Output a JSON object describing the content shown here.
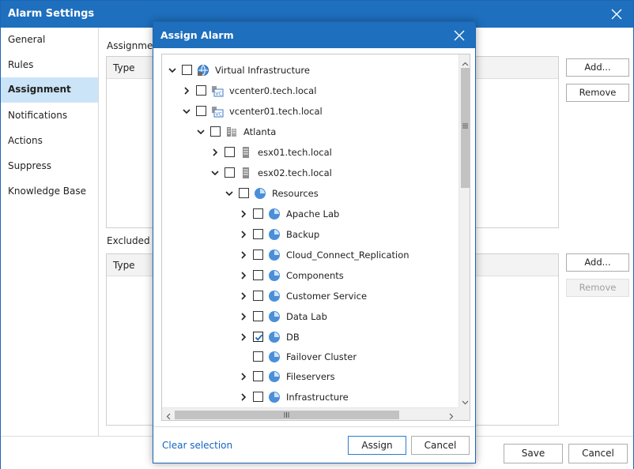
{
  "window": {
    "title": "Alarm Settings"
  },
  "sidebar": {
    "items": [
      {
        "label": "General"
      },
      {
        "label": "Rules"
      },
      {
        "label": "Assignment"
      },
      {
        "label": "Notifications"
      },
      {
        "label": "Actions"
      },
      {
        "label": "Suppress"
      },
      {
        "label": "Knowledge Base"
      }
    ],
    "active": "Assignment"
  },
  "assignment": {
    "assign_label": "Assignment",
    "assign_type_header": "Type",
    "excluded_label": "Excluded ob",
    "excluded_type_header": "Type",
    "add_label": "Add...",
    "remove_label": "Remove",
    "add2_label": "Add...",
    "remove2_label": "Remove"
  },
  "footer": {
    "save_label": "Save",
    "cancel_label": "Cancel"
  },
  "dialog": {
    "title": "Assign Alarm",
    "clear_label": "Clear selection",
    "assign_label": "Assign",
    "cancel_label": "Cancel",
    "tree": [
      {
        "label": "Virtual Infrastructure",
        "icon": "globe-icon",
        "expanded": true,
        "checked": false
      },
      {
        "label": "vcenter0.tech.local",
        "icon": "vcenter-icon",
        "expanded": false,
        "checked": false
      },
      {
        "label": "vcenter01.tech.local",
        "icon": "vcenter-icon",
        "expanded": true,
        "checked": false
      },
      {
        "label": "Atlanta",
        "icon": "datacenter-icon",
        "expanded": true,
        "checked": false
      },
      {
        "label": "esx01.tech.local",
        "icon": "host-icon",
        "expanded": false,
        "checked": false
      },
      {
        "label": "esx02.tech.local",
        "icon": "host-icon",
        "expanded": true,
        "checked": false
      },
      {
        "label": "Resources",
        "icon": "resource-pool-icon",
        "expanded": true,
        "checked": false
      },
      {
        "label": "Apache Lab",
        "icon": "resource-pool-icon",
        "expanded": false,
        "checked": false
      },
      {
        "label": "Backup",
        "icon": "resource-pool-icon",
        "expanded": false,
        "checked": false
      },
      {
        "label": "Cloud_Connect_Replication",
        "icon": "resource-pool-icon",
        "expanded": false,
        "checked": false
      },
      {
        "label": "Components",
        "icon": "resource-pool-icon",
        "expanded": false,
        "checked": false
      },
      {
        "label": "Customer Service",
        "icon": "resource-pool-icon",
        "expanded": false,
        "checked": false
      },
      {
        "label": "Data Lab",
        "icon": "resource-pool-icon",
        "expanded": false,
        "checked": false
      },
      {
        "label": "DB",
        "icon": "resource-pool-icon",
        "expanded": false,
        "checked": true
      },
      {
        "label": "Failover Cluster",
        "icon": "resource-pool-icon",
        "expanded": null,
        "checked": false
      },
      {
        "label": "Fileservers",
        "icon": "resource-pool-icon",
        "expanded": false,
        "checked": false
      },
      {
        "label": "Infrastructure",
        "icon": "resource-pool-icon",
        "expanded": false,
        "checked": false
      }
    ]
  },
  "colors": {
    "titlebar": "#1e6fbd",
    "active_nav": "#cce4f7",
    "link": "#1565c0"
  }
}
